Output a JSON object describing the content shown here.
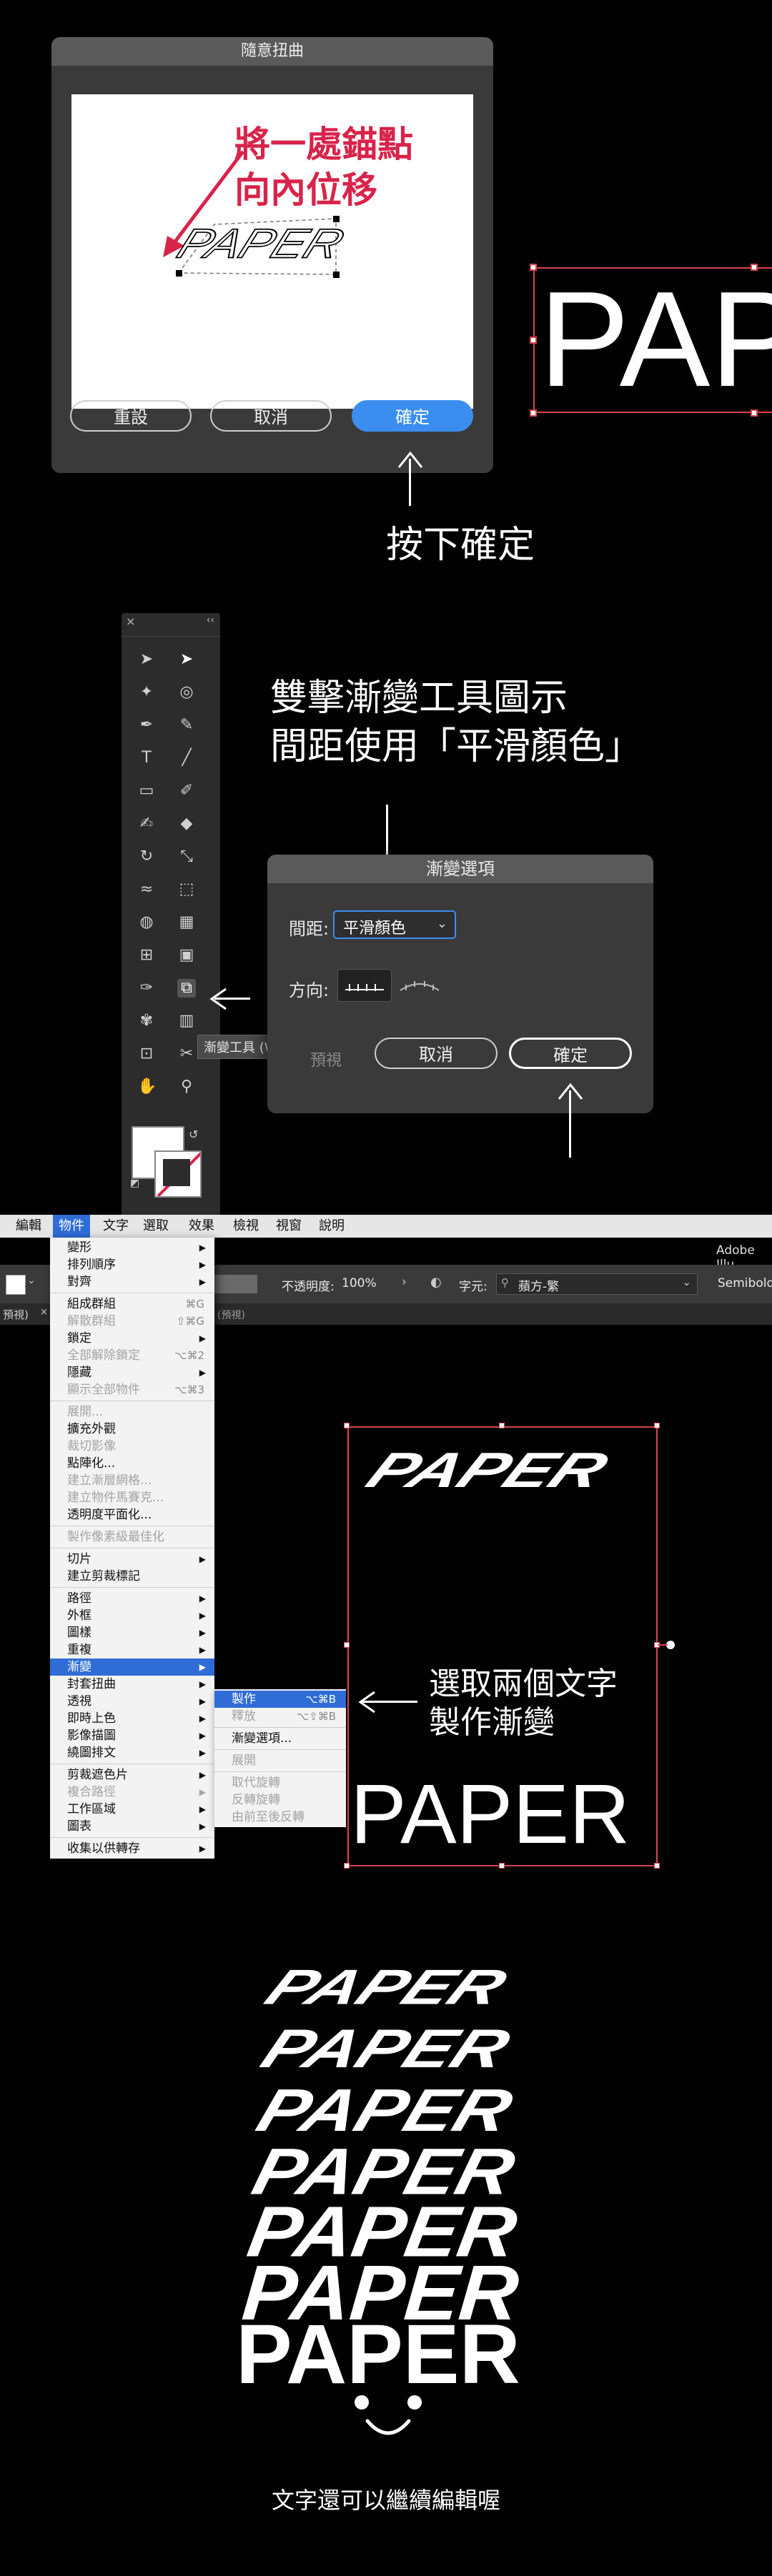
{
  "warp_dialog": {
    "title": "隨意扭曲",
    "annotation_line1": "將一處錨點",
    "annotation_line2": "向內位移",
    "preview_word": "PAPER",
    "reset_label": "重設",
    "cancel_label": "取消",
    "ok_label": "確定"
  },
  "canvas_top": {
    "word": "PAP"
  },
  "caption_press_ok": "按下確定",
  "caption_blend": {
    "line1": "雙擊漸變工具圖示",
    "line2": "間距使用「平滑顏色」"
  },
  "toolbar": {
    "tooltip": "漸變工具 (W)",
    "collapse_icon": "×",
    "expand_icon": "‹‹"
  },
  "blend_dialog": {
    "title": "漸變選項",
    "spacing_label": "間距:",
    "spacing_value": "平滑顏色",
    "orientation_label": "方向:",
    "preview_label": "預視",
    "cancel_label": "取消",
    "ok_label": "確定"
  },
  "menubar": {
    "items": [
      "編輯",
      "物件",
      "文字",
      "選取",
      "效果",
      "檢視",
      "視窗",
      "說明"
    ],
    "app_name": "Adobe Illu"
  },
  "control_bar": {
    "opacity_label": "不透明度:",
    "opacity_value": "100%",
    "char_label": "字元:",
    "font_value": "蘋方-繁",
    "weight_value": "Semibold"
  },
  "tab_bar": {
    "tab_label": "預視)",
    "doc_label": "(預視)"
  },
  "object_menu": {
    "items": [
      {
        "label": "變形",
        "sub": "▶"
      },
      {
        "label": "排列順序",
        "sub": "▶"
      },
      {
        "label": "對齊",
        "sub": "▶"
      },
      {
        "sep": true
      },
      {
        "label": "組成群組",
        "sc": "⌘G"
      },
      {
        "label": "解散群組",
        "sc": "⇧⌘G",
        "dis": true
      },
      {
        "label": "鎖定",
        "sub": "▶"
      },
      {
        "label": "全部解除鎖定",
        "sc": "⌥⌘2",
        "dis": true
      },
      {
        "label": "隱藏",
        "sub": "▶"
      },
      {
        "label": "顯示全部物件",
        "sc": "⌥⌘3",
        "dis": true
      },
      {
        "sep": true
      },
      {
        "label": "展開...",
        "dis": true
      },
      {
        "label": "擴充外觀"
      },
      {
        "label": "裁切影像",
        "dis": true
      },
      {
        "label": "點陣化..."
      },
      {
        "label": "建立漸層網格...",
        "dis": true
      },
      {
        "label": "建立物件馬賽克...",
        "dis": true
      },
      {
        "label": "透明度平面化..."
      },
      {
        "sep": true
      },
      {
        "label": "製作像素級最佳化",
        "dis": true
      },
      {
        "sep": true
      },
      {
        "label": "切片",
        "sub": "▶"
      },
      {
        "label": "建立剪裁標記"
      },
      {
        "sep": true
      },
      {
        "label": "路徑",
        "sub": "▶"
      },
      {
        "label": "外框",
        "sub": "▶"
      },
      {
        "label": "圖樣",
        "sub": "▶"
      },
      {
        "label": "重複",
        "sub": "▶"
      },
      {
        "label": "漸變",
        "sub": "▶",
        "sel": true
      },
      {
        "label": "封套扭曲",
        "sub": "▶"
      },
      {
        "label": "透視",
        "sub": "▶"
      },
      {
        "label": "即時上色",
        "sub": "▶"
      },
      {
        "label": "影像描圖",
        "sub": "▶"
      },
      {
        "label": "繞圖排文",
        "sub": "▶"
      },
      {
        "sep": true
      },
      {
        "label": "剪裁遮色片",
        "sub": "▶"
      },
      {
        "label": "複合路徑",
        "sub": "▶",
        "dis": true
      },
      {
        "label": "工作區域",
        "sub": "▶"
      },
      {
        "label": "圖表",
        "sub": "▶"
      },
      {
        "sep": true
      },
      {
        "label": "收集以供轉存",
        "sub": "▶"
      }
    ]
  },
  "blend_submenu": {
    "items": [
      {
        "label": "製作",
        "sc": "⌥⌘B",
        "sel": true
      },
      {
        "label": "釋放",
        "sc": "⌥⇧⌘B",
        "dis": true
      },
      {
        "sep": true
      },
      {
        "label": "漸變選項..."
      },
      {
        "sep": true
      },
      {
        "label": "展開",
        "dis": true
      },
      {
        "sep": true
      },
      {
        "label": "取代旋轉",
        "dis": true
      },
      {
        "label": "反轉旋轉",
        "dis": true
      },
      {
        "label": "由前至後反轉",
        "dis": true
      }
    ]
  },
  "artboard": {
    "word_top": "PAPER",
    "word_bottom": "PAPER"
  },
  "caption_select": {
    "line1": "選取兩個文字",
    "line2": "製作漸變"
  },
  "result": {
    "words": [
      "PAPER",
      "PAPER",
      "PAPER",
      "PAPER",
      "PAPER",
      "PAPER",
      "PAPER"
    ]
  },
  "footer_text": "文字還可以繼續編輯喔",
  "colors": {
    "accent_blue": "#3b8ef0",
    "annotation_red": "#d8244a",
    "selection_red": "#d94452",
    "menu_highlight": "#2f6cd6"
  }
}
